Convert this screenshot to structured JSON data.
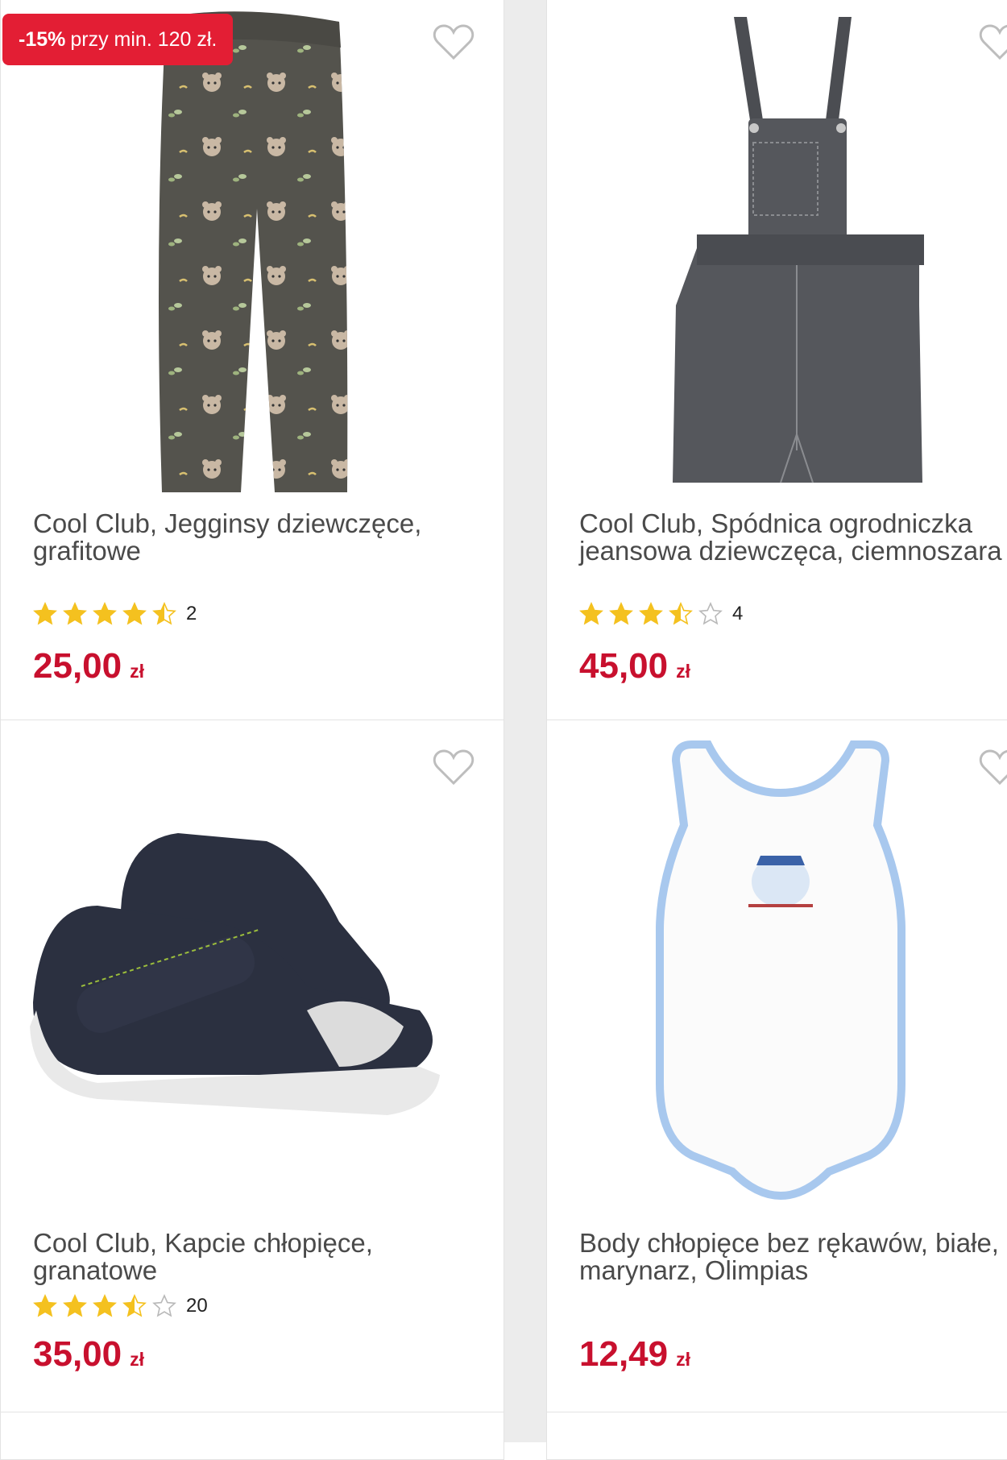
{
  "products": [
    {
      "title": "Cool Club, Jegginsy dziewczęce, grafitowe",
      "badge": {
        "discount": "-15%",
        "text": "przy min. 120 zł."
      },
      "rating": 4.5,
      "rating_count": "2",
      "price": "25,00",
      "currency": "zł",
      "image": "graphite-leggings-with-bear-print"
    },
    {
      "title": "Cool Club, Spódnica ogrodniczka jeansowa dziewczęca, ciemnoszara",
      "rating": 3.5,
      "rating_count": "4",
      "price": "45,00",
      "currency": "zł",
      "image": "dark-grey-denim-pinafore-dress"
    },
    {
      "title": "Cool Club, Kapcie chłopięce, granatowe",
      "rating": 3.5,
      "rating_count": "20",
      "price": "35,00",
      "currency": "zł",
      "image": "navy-velcro-sandal-slippers"
    },
    {
      "title": "Body chłopięce bez rękawów, białe, marynarz, Olimpias",
      "price": "12,49",
      "currency": "zł",
      "image": "white-sleeveless-bodysuit-blue-trim"
    }
  ],
  "colors": {
    "price": "#c8102e",
    "badge": "#e31e34",
    "star": "#f4c11f",
    "star_empty": "#b9b9b9",
    "heart": "#bdbdbd"
  },
  "icons": {
    "wishlist": "heart-outline-icon",
    "rating": "star-icon"
  }
}
